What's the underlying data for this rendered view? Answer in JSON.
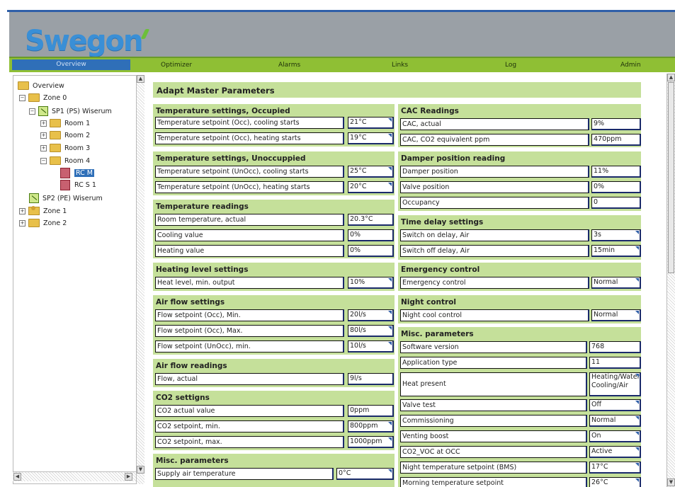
{
  "brand": {
    "logo_text": "Swegon"
  },
  "nav": {
    "overview": "Overview",
    "optimizer": "Optimizer",
    "alarms": "Alarms",
    "links": "Links",
    "log": "Log",
    "admin": "Admin"
  },
  "tree": {
    "overview": "Overview",
    "zone0": "Zone 0",
    "sp1": "SP1 (PS) Wiserum",
    "room1": "Room 1",
    "room2": "Room 2",
    "room3": "Room 3",
    "room4": "Room 4",
    "rcm": "RC M",
    "rcs1": "RC S 1",
    "sp2": "SP2 (PE) Wiserum",
    "zone1": "Zone 1",
    "zone2": "Zone 2"
  },
  "page": {
    "title": "Adapt Master Parameters"
  },
  "left": {
    "occ": {
      "title": "Temperature settings, Occupied",
      "r1": {
        "label": "Temperature setpoint (Occ), cooling starts",
        "value": "21°C"
      },
      "r2": {
        "label": "Temperature setpoint (Occ), heating starts",
        "value": "19°C"
      }
    },
    "unocc": {
      "title": "Temperature settings, Unoccuppied",
      "r1": {
        "label": "Temperature setpoint (UnOcc), cooling starts",
        "value": "25°C"
      },
      "r2": {
        "label": "Temperature setpoint (UnOcc), heating starts",
        "value": "20°C"
      }
    },
    "readings": {
      "title": "Temperature readings",
      "r1": {
        "label": "Room temperature, actual",
        "value": "20.3°C"
      },
      "r2": {
        "label": "Cooling value",
        "value": "0%"
      },
      "r3": {
        "label": "Heating value",
        "value": "0%"
      }
    },
    "heatlevel": {
      "title": "Heating level settings",
      "r1": {
        "label": "Heat level, min. output",
        "value": "10%"
      }
    },
    "airflow": {
      "title": "Air flow settings",
      "r1": {
        "label": "Flow setpoint (Occ), Min.",
        "value": "20l/s"
      },
      "r2": {
        "label": "Flow setpoint (Occ), Max.",
        "value": "80l/s"
      },
      "r3": {
        "label": "Flow setpoint (UnOcc), min.",
        "value": "10l/s"
      }
    },
    "airread": {
      "title": "Air flow readings",
      "r1": {
        "label": "Flow, actual",
        "value": "9l/s"
      }
    },
    "co2": {
      "title": "CO2 settigns",
      "r1": {
        "label": "CO2 actual value",
        "value": "0ppm"
      },
      "r2": {
        "label": "CO2 setpoint, min.",
        "value": "800ppm"
      },
      "r3": {
        "label": "CO2 setpoint, max.",
        "value": "1000ppm"
      }
    },
    "misc": {
      "title": "Misc. parameters",
      "r1": {
        "label": "Supply air temperature",
        "value": "0°C"
      }
    }
  },
  "right": {
    "cac": {
      "title": "CAC Readings",
      "r1": {
        "label": "CAC, actual",
        "value": "9%"
      },
      "r2": {
        "label": "CAC, CO2 equivalent ppm",
        "value": "470ppm"
      }
    },
    "damper": {
      "title": "Damper position reading",
      "r1": {
        "label": "Damper position",
        "value": "11%"
      },
      "r2": {
        "label": "Valve position",
        "value": "0%"
      },
      "r3": {
        "label": "Occupancy",
        "value": "0"
      }
    },
    "timedelay": {
      "title": "Time delay settings",
      "r1": {
        "label": "Switch on delay, Air",
        "value": "3s"
      },
      "r2": {
        "label": "Switch off delay, Air",
        "value": "15min"
      }
    },
    "emergency": {
      "title": "Emergency control",
      "r1": {
        "label": "Emergency control",
        "value": "Normal"
      }
    },
    "night": {
      "title": "Night control",
      "r1": {
        "label": "Night cool control",
        "value": "Normal"
      }
    },
    "misc": {
      "title": "Misc. parameters",
      "r1": {
        "label": "Software version",
        "value": "768"
      },
      "r2": {
        "label": "Application type",
        "value": "11"
      },
      "r3": {
        "label": "Heat present",
        "value": "Heating/Water, Cooling/Air"
      },
      "r4": {
        "label": "Valve test",
        "value": "Off"
      },
      "r5": {
        "label": "Commissioning",
        "value": "Normal"
      },
      "r6": {
        "label": "Venting boost",
        "value": "On"
      },
      "r7": {
        "label": "CO2_VOC at OCC",
        "value": "Active"
      },
      "r8": {
        "label": "Night temperature setpoint (BMS)",
        "value": "17°C"
      },
      "r9": {
        "label": "Morning temperature setpoint",
        "value": "26°C"
      }
    }
  }
}
